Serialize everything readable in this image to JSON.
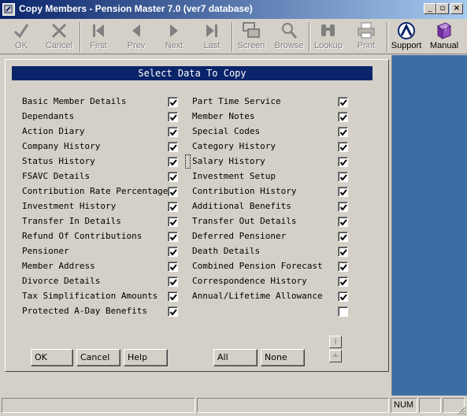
{
  "window": {
    "title": "Copy Members - Pension Master 7.0 (ver7 database)"
  },
  "toolbar": {
    "buttons": [
      {
        "label": "OK",
        "icon": "check-icon"
      },
      {
        "label": "Cancel",
        "icon": "x-icon"
      },
      {
        "label": "First",
        "icon": "first-icon"
      },
      {
        "label": "Prev",
        "icon": "prev-icon"
      },
      {
        "label": "Next",
        "icon": "next-icon"
      },
      {
        "label": "Last",
        "icon": "last-icon"
      },
      {
        "label": "Screen",
        "icon": "screen-icon"
      },
      {
        "label": "Browse",
        "icon": "magnifier-icon"
      },
      {
        "label": "Lookup",
        "icon": "binoculars-icon"
      },
      {
        "label": "Print",
        "icon": "printer-icon"
      },
      {
        "label": "Support",
        "icon": "support-icon"
      },
      {
        "label": "Manual",
        "icon": "book-icon"
      }
    ]
  },
  "dialog": {
    "title": "Select Data To Copy",
    "left_items": [
      {
        "label": "Basic Member Details",
        "checked": true
      },
      {
        "label": "Dependants",
        "checked": true
      },
      {
        "label": "Action Diary",
        "checked": true
      },
      {
        "label": "Company History",
        "checked": true
      },
      {
        "label": "Status History",
        "checked": true
      },
      {
        "label": "FSAVC Details",
        "checked": true
      },
      {
        "label": "Contribution Rate Percentages",
        "checked": true
      },
      {
        "label": "Investment History",
        "checked": true
      },
      {
        "label": "Transfer In Details",
        "checked": true
      },
      {
        "label": "Refund Of Contributions",
        "checked": true
      },
      {
        "label": "Pensioner",
        "checked": true
      },
      {
        "label": "Member Address",
        "checked": true
      },
      {
        "label": "Divorce Details",
        "checked": true
      },
      {
        "label": "Tax Simplification Amounts",
        "checked": true
      },
      {
        "label": "Protected A-Day Benefits",
        "checked": true
      }
    ],
    "right_items": [
      {
        "label": "Part Time Service",
        "checked": true
      },
      {
        "label": "Member Notes",
        "checked": true
      },
      {
        "label": "Special Codes",
        "checked": true
      },
      {
        "label": "Category History",
        "checked": true
      },
      {
        "label": "Salary History",
        "checked": true
      },
      {
        "label": "Investment Setup",
        "checked": true
      },
      {
        "label": "Contribution History",
        "checked": true
      },
      {
        "label": "Additional Benefits",
        "checked": true
      },
      {
        "label": "Transfer Out Details",
        "checked": true
      },
      {
        "label": "Deferred Pensioner",
        "checked": true
      },
      {
        "label": "Death Details",
        "checked": true
      },
      {
        "label": "Combined Pension Forecast",
        "checked": true
      },
      {
        "label": "Correspondence History",
        "checked": true
      },
      {
        "label": "Annual/Lifetime Allowance",
        "checked": true
      },
      {
        "label": "",
        "checked": false
      }
    ],
    "buttons": {
      "ok": "OK",
      "cancel": "Cancel",
      "help": "Help",
      "all": "All",
      "none": "None"
    }
  },
  "statusbar": {
    "num": "NUM"
  }
}
